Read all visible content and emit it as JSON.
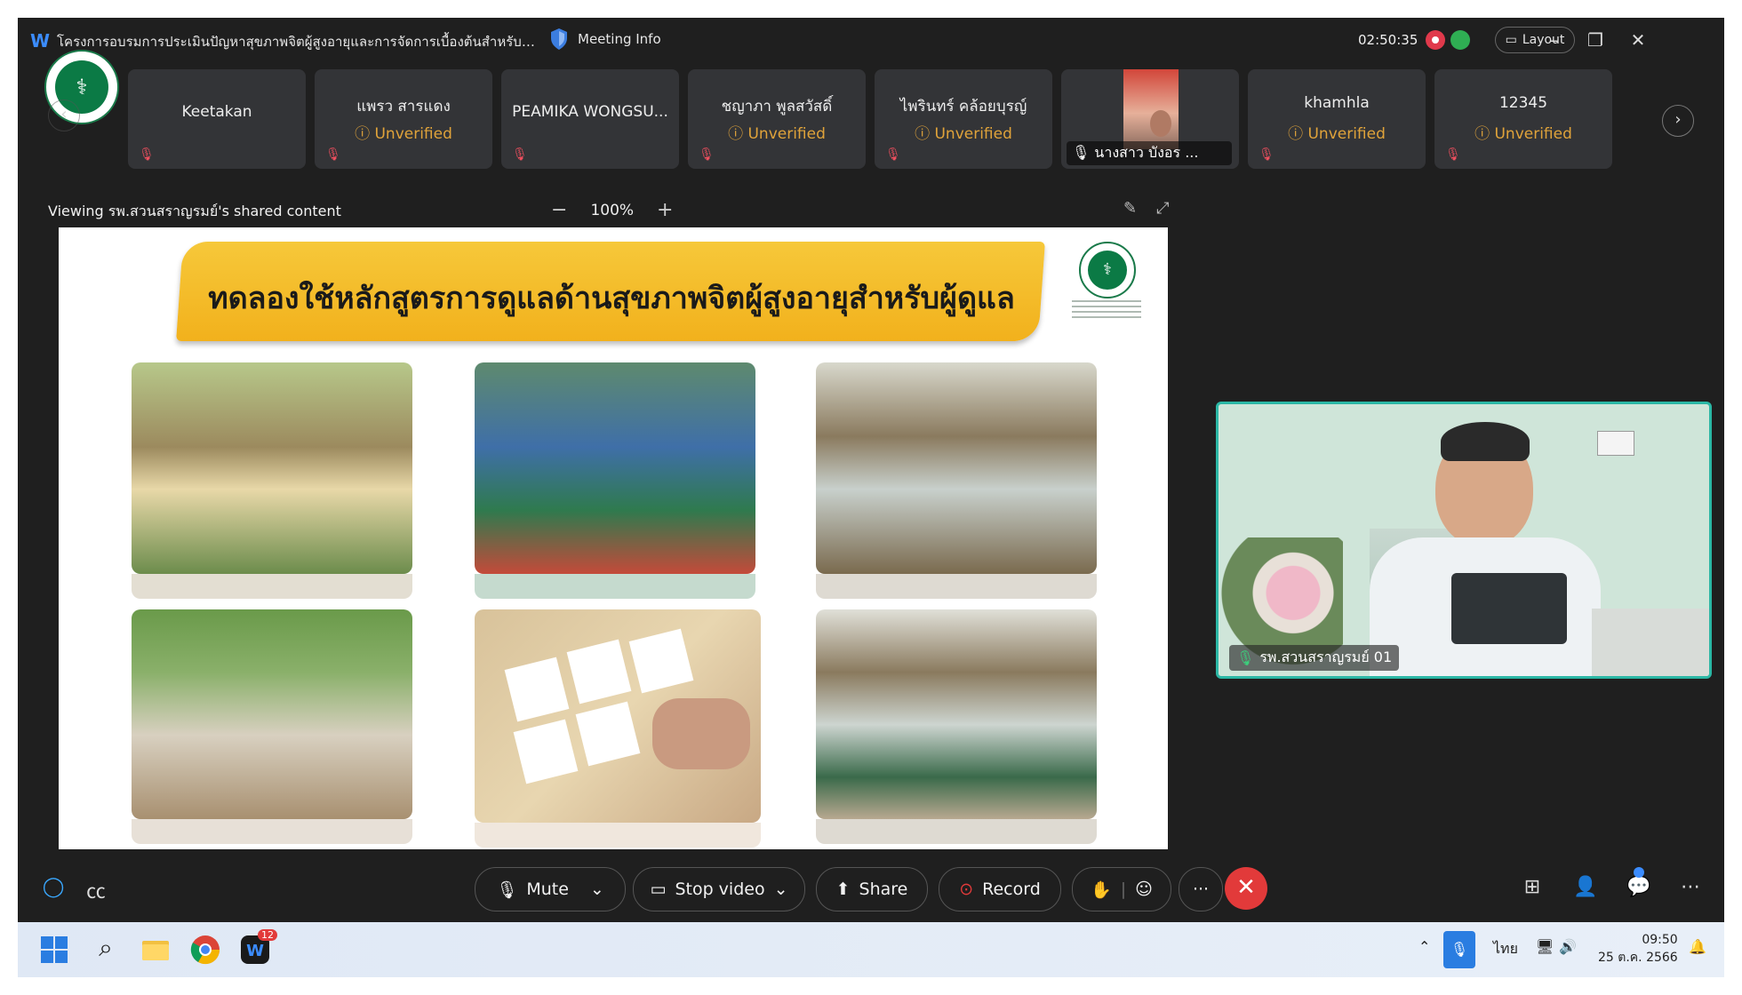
{
  "window": {
    "title": "โครงการอบรมการประเมินปัญหาสุขภาพจิตผู้สูงอายุและการจัดการเบื้องต้นสำหรับผู้...",
    "meeting_info": "Meeting Info",
    "timer": "02:50:35",
    "layout_label": "Layout"
  },
  "participants": [
    {
      "name": "Keetakan",
      "status": ""
    },
    {
      "name": "แพรว สารแดง",
      "status": "Unverified"
    },
    {
      "name": "PEAMIKA WONGSU...",
      "status": ""
    },
    {
      "name": "ชญาภา พูลสวัสดิ์",
      "status": "Unverified"
    },
    {
      "name": "ไพรินทร์ คล้อยบุรญ์",
      "status": "Unverified"
    },
    {
      "name": "นางสาว บังอร ...",
      "status": ""
    },
    {
      "name": "khamhla",
      "status": "Unverified"
    },
    {
      "name": "12345",
      "status": "Unverified"
    }
  ],
  "share": {
    "viewing_label": "Viewing รพ.สวนสราญรมย์'s shared content",
    "zoom_level": "100%",
    "zoom_minus": "−",
    "zoom_plus": "+"
  },
  "slide": {
    "title": "ทดลองใช้หลักสูตรการดูแลด้านสุขภาพจิตผู้สูงอายุสำหรับผู้ดูแล"
  },
  "speaker": {
    "label": "รพ.สวนสราญรมย์ 01"
  },
  "toolbar": {
    "mute": "Mute",
    "stop_video": "Stop video",
    "share": "Share",
    "record": "Record",
    "more": "···"
  },
  "taskbar": {
    "language": "ไทย",
    "time": "09:50",
    "date": "25 ต.ค. 2566",
    "webex_badge": "12"
  },
  "colors": {
    "accent_teal": "#2bb7a5",
    "unverified": "#e0a33a",
    "end_call": "#e23a3a",
    "banner_yellow": "#f2b11c"
  }
}
